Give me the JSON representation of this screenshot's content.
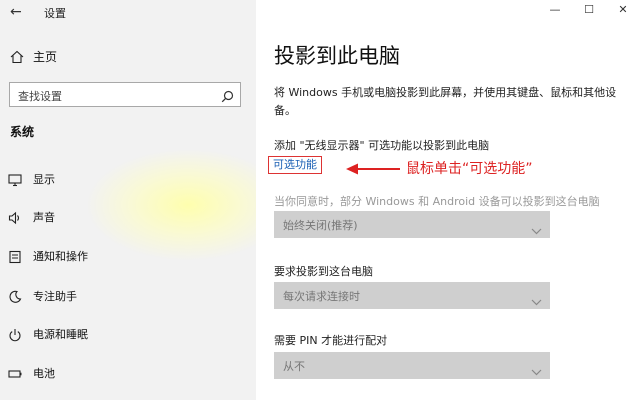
{
  "window": {
    "title": "设置",
    "minimize": "—",
    "maximize": "☐",
    "close": "✕"
  },
  "sidebar": {
    "home_label": "主页",
    "search_placeholder": "查找设置",
    "section_title": "系统",
    "items": [
      {
        "label": "显示",
        "icon": "monitor-icon"
      },
      {
        "label": "声音",
        "icon": "speaker-icon"
      },
      {
        "label": "通知和操作",
        "icon": "notification-icon"
      },
      {
        "label": "专注助手",
        "icon": "moon-icon"
      },
      {
        "label": "电源和睡眠",
        "icon": "power-icon"
      },
      {
        "label": "电池",
        "icon": "battery-icon"
      }
    ]
  },
  "main": {
    "title": "投影到此电脑",
    "description": "将 Windows 手机或电脑投影到此屏幕，并使用其键盘、鼠标和其他设备。",
    "add_text": "添加 \"无线显示器\" 可选功能以投影到此电脑",
    "optional_link": "可选功能",
    "annotation": "鼠标单击“可选功能”",
    "settings": [
      {
        "label": "当你同意时，部分 Windows 和 Android 设备可以投影到这台电脑",
        "value": "始终关闭(推荐)"
      },
      {
        "label": "要求投影到这台电脑",
        "value": "每次请求连接时"
      },
      {
        "label": "需要 PIN 才能进行配对",
        "value": "从不"
      }
    ]
  },
  "colors": {
    "link": "#1a5fb4",
    "annotation": "#dd2222",
    "dropdown_bg": "#cfcfcf",
    "sidebar_bg": "#f2f2f2"
  }
}
